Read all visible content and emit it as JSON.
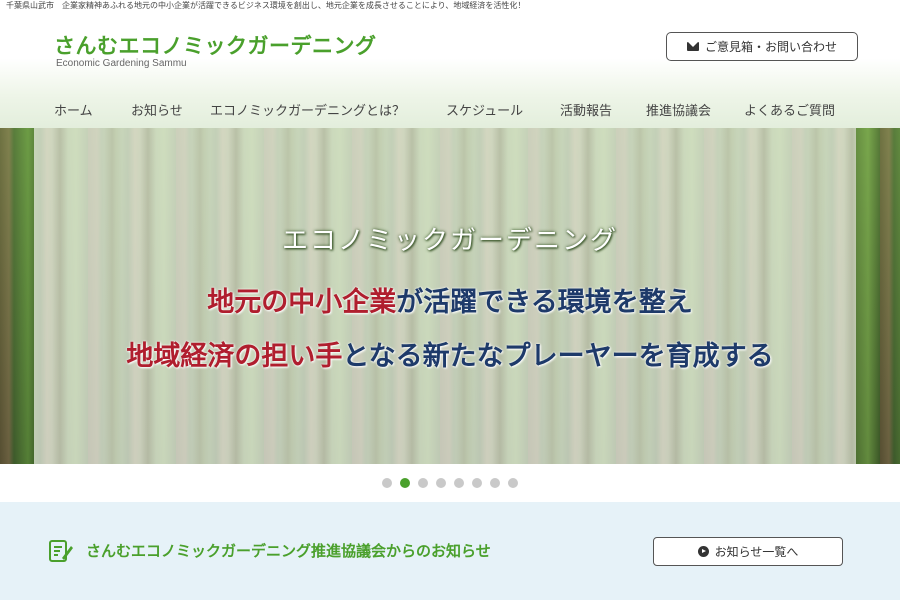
{
  "tagline": "千葉県山武市　企業家精神あふれる地元の中小企業が活躍できるビジネス環境を創出し、地元企業を成長させることにより、地域経済を活性化！",
  "header": {
    "logo_title": "さんむエコノミックガーデニング",
    "logo_subtitle": "Economic Gardening Sammu",
    "contact_label": "ご意見箱・お問い合わせ"
  },
  "nav": {
    "items": [
      {
        "label": "ホーム"
      },
      {
        "label": "お知らせ"
      },
      {
        "label": "エコノミックガーデニングとは？"
      },
      {
        "label": "スケジュール"
      },
      {
        "label": "活動報告"
      },
      {
        "label": "推進協議会"
      },
      {
        "label": "よくあるご質問"
      }
    ]
  },
  "hero": {
    "heading": "エコノミックガーデニング",
    "line1_red": "地元の中小企業",
    "line1_rest": "が活躍できる環境を整え",
    "line2_red": "地域経済の担い手",
    "line2_rest": "となる新たなプレーヤーを育成する"
  },
  "carousel": {
    "slide_count": 8,
    "active_index": 1
  },
  "news": {
    "title": "さんむエコノミックガーデニング推進協議会からのお知らせ",
    "list_button": "お知らせ一覧へ"
  },
  "colors": {
    "brand_green": "#4aa02c",
    "accent_red": "#b01e2e",
    "accent_navy": "#1e3a6a",
    "news_band": "#e6f2f8"
  },
  "icons": {
    "contact": "mail-icon",
    "news": "memo-pencil-icon",
    "list_button": "circle-arrow-right-icon"
  }
}
